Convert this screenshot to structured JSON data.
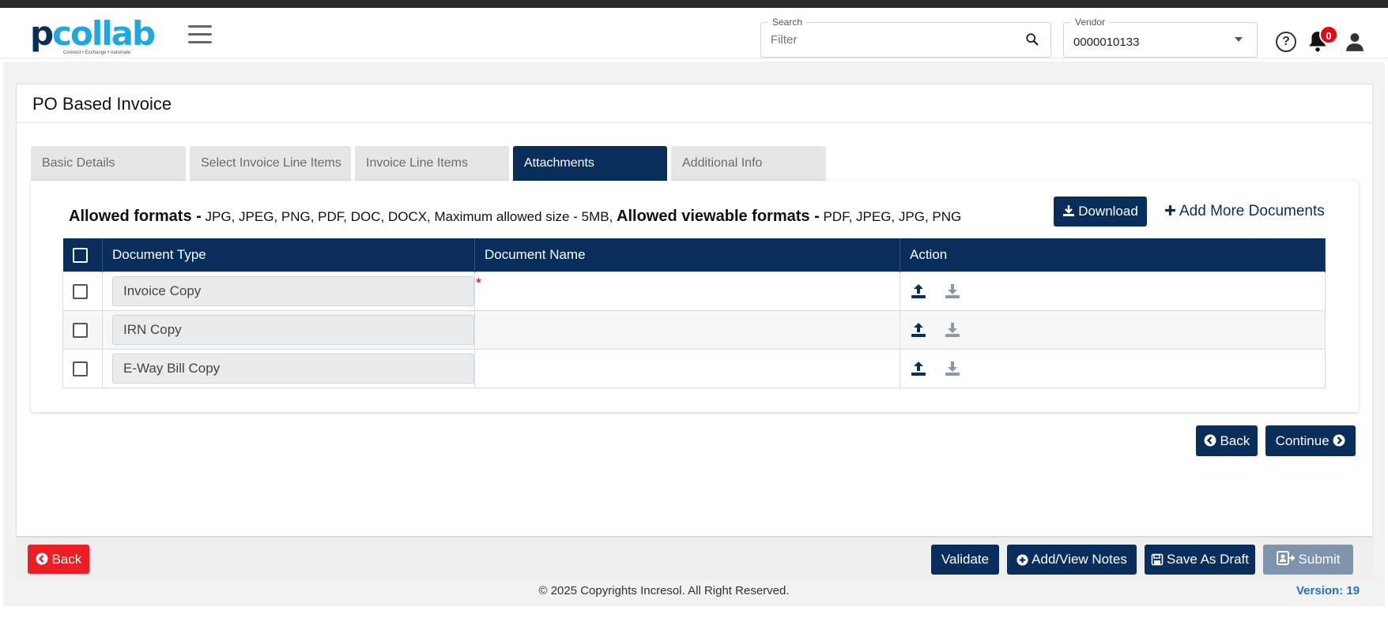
{
  "header": {
    "logo_text": "collab",
    "logo_letter": "p",
    "logo_tagline": "Connect • Exchange • Automate",
    "search": {
      "label": "Search",
      "placeholder": "Filter"
    },
    "vendor": {
      "label": "Vendor",
      "value": "0000010133"
    },
    "help_symbol": "?",
    "notification_count": "0"
  },
  "page": {
    "title": "PO Based Invoice",
    "tabs": [
      {
        "label": "Basic Details",
        "active": false
      },
      {
        "label": "Select Invoice Line Items",
        "active": false
      },
      {
        "label": "Invoice Line Items",
        "active": false
      },
      {
        "label": "Attachments",
        "active": true
      },
      {
        "label": "Additional Info",
        "active": false
      }
    ]
  },
  "attachments": {
    "allowed_formats_label": "Allowed formats -",
    "allowed_formats_value": " JPG, JPEG, PNG, PDF, DOC, DOCX, Maximum allowed size - 5MB, ",
    "viewable_formats_label": "Allowed viewable formats -",
    "viewable_formats_value": " PDF, JPEG, JPG, PNG",
    "download_label": "Download",
    "add_more_label": "Add More Documents",
    "columns": [
      "",
      "Document Type",
      "Document Name",
      "Action"
    ],
    "rows": [
      {
        "document_type": "Invoice Copy",
        "document_name": "",
        "required": true
      },
      {
        "document_type": "IRN Copy",
        "document_name": "",
        "required": false
      },
      {
        "document_type": "E-Way Bill Copy",
        "document_name": "",
        "required": false
      }
    ],
    "required_marker": "*"
  },
  "nav": {
    "back_label": "Back",
    "continue_label": "Continue"
  },
  "footer": {
    "back_label": "Back",
    "validate_label": "Validate",
    "notes_label": "Add/View Notes",
    "draft_label": "Save As Draft",
    "submit_label": "Submit",
    "copyright": "© 2025 Copyrights Incresol. All Right Reserved.",
    "version": "Version: 19"
  },
  "colors": {
    "primary": "#0a2e5c",
    "danger": "#ee1d23",
    "brand_blue": "#1ea7e1",
    "badge": "#e30613",
    "disabled": "#7d93ae"
  }
}
